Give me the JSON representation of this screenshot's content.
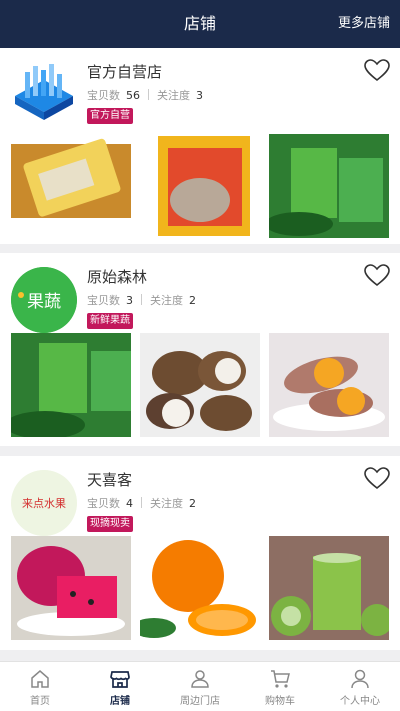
{
  "header": {
    "title": "店铺",
    "more": "更多店铺"
  },
  "stores": [
    {
      "name": "官方自营店",
      "items_label": "宝贝数",
      "items_value": "56",
      "follow_label": "关注度",
      "follow_value": "3",
      "tag": "官方自营",
      "tag_color": "#c2185b"
    },
    {
      "name": "原始森林",
      "items_label": "宝贝数",
      "items_value": "3",
      "follow_label": "关注度",
      "follow_value": "2",
      "tag": "新鲜果蔬",
      "tag_color": "#c2185b",
      "logo_text": "果蔬"
    },
    {
      "name": "天喜客",
      "items_label": "宝贝数",
      "items_value": "4",
      "follow_label": "关注度",
      "follow_value": "2",
      "tag": "现摘现卖",
      "tag_color": "#c2185b",
      "logo_text": "来点水果"
    }
  ],
  "tabbar": {
    "items": [
      {
        "label": "首页",
        "icon": "home-icon"
      },
      {
        "label": "店铺",
        "icon": "store-icon",
        "active": true
      },
      {
        "label": "周边门店",
        "icon": "person-icon"
      },
      {
        "label": "购物车",
        "icon": "cart-icon"
      },
      {
        "label": "个人中心",
        "icon": "user-icon"
      }
    ]
  },
  "colors": {
    "header_bg": "#1b2a4a",
    "tag_bg": "#c2185b",
    "active_tab": "#1b2a4a"
  }
}
